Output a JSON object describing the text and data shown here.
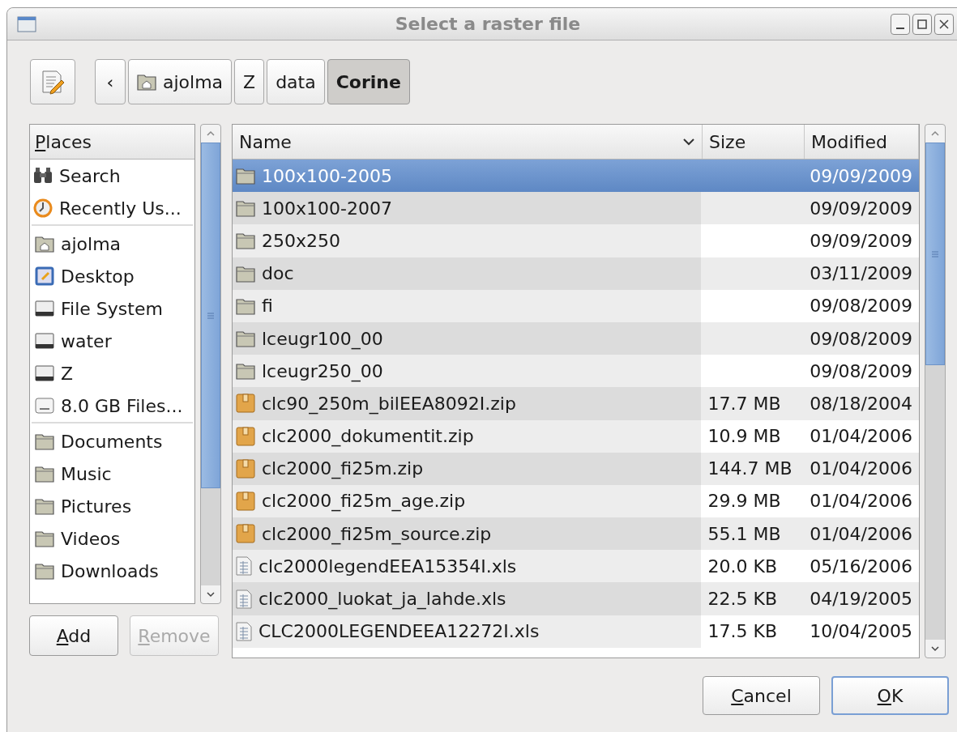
{
  "window": {
    "title": "Select a raster file"
  },
  "path_bar": {
    "back": "‹",
    "items": [
      {
        "label": "ajolma",
        "kind": "home",
        "selected": false
      },
      {
        "label": "Z",
        "kind": "plain",
        "selected": false
      },
      {
        "label": "data",
        "kind": "plain",
        "selected": false
      },
      {
        "label": "Corine",
        "kind": "plain",
        "selected": true
      }
    ]
  },
  "places": {
    "header": "Places",
    "header_mnemonic": true,
    "groups": [
      [
        {
          "label": "Search",
          "kind": "search"
        },
        {
          "label": "Recently Us...",
          "kind": "recent"
        }
      ],
      [
        {
          "label": "ajolma",
          "kind": "home"
        },
        {
          "label": "Desktop",
          "kind": "desktop"
        },
        {
          "label": "File System",
          "kind": "drive"
        },
        {
          "label": "water",
          "kind": "drive"
        },
        {
          "label": "Z",
          "kind": "drive"
        },
        {
          "label": "8.0 GB Files...",
          "kind": "removable"
        }
      ],
      [
        {
          "label": "Documents",
          "kind": "folder"
        },
        {
          "label": "Music",
          "kind": "folder"
        },
        {
          "label": "Pictures",
          "kind": "folder"
        },
        {
          "label": "Videos",
          "kind": "folder"
        },
        {
          "label": "Downloads",
          "kind": "folder"
        }
      ]
    ]
  },
  "place_buttons": [
    {
      "label": "Add",
      "disabled": false,
      "mnemonic": true
    },
    {
      "label": "Remove",
      "disabled": true,
      "mnemonic": true
    }
  ],
  "files": {
    "columns": [
      "Name",
      "Size",
      "Modified"
    ],
    "rows": [
      {
        "name": "100x100-2005",
        "size": "",
        "modified": "09/09/2009",
        "kind": "folder",
        "selected": true
      },
      {
        "name": "100x100-2007",
        "size": "",
        "modified": "09/09/2009",
        "kind": "folder",
        "selected": false
      },
      {
        "name": "250x250",
        "size": "",
        "modified": "09/09/2009",
        "kind": "folder",
        "selected": false
      },
      {
        "name": "doc",
        "size": "",
        "modified": "03/11/2009",
        "kind": "folder",
        "selected": false
      },
      {
        "name": "fi",
        "size": "",
        "modified": "09/08/2009",
        "kind": "folder",
        "selected": false
      },
      {
        "name": "lceugr100_00",
        "size": "",
        "modified": "09/08/2009",
        "kind": "folder",
        "selected": false
      },
      {
        "name": "lceugr250_00",
        "size": "",
        "modified": "09/08/2009",
        "kind": "folder",
        "selected": false
      },
      {
        "name": "clc90_250m_bilEEA8092I.zip",
        "size": "17.7 MB",
        "modified": "08/18/2004",
        "kind": "archive",
        "selected": false
      },
      {
        "name": "clc2000_dokumentit.zip",
        "size": "10.9 MB",
        "modified": "01/04/2006",
        "kind": "archive",
        "selected": false
      },
      {
        "name": "clc2000_fi25m.zip",
        "size": "144.7 MB",
        "modified": "01/04/2006",
        "kind": "archive",
        "selected": false
      },
      {
        "name": "clc2000_fi25m_age.zip",
        "size": "29.9 MB",
        "modified": "01/04/2006",
        "kind": "archive",
        "selected": false
      },
      {
        "name": "clc2000_fi25m_source.zip",
        "size": "55.1 MB",
        "modified": "01/04/2006",
        "kind": "archive",
        "selected": false
      },
      {
        "name": "clc2000legendEEA15354I.xls",
        "size": "20.0 KB",
        "modified": "05/16/2006",
        "kind": "spreadsheet",
        "selected": false
      },
      {
        "name": "clc2000_luokat_ja_lahde.xls",
        "size": "22.5 KB",
        "modified": "04/19/2005",
        "kind": "spreadsheet",
        "selected": false
      },
      {
        "name": "CLC2000LEGENDEEA12272I.xls",
        "size": "17.5 KB",
        "modified": "10/04/2005",
        "kind": "spreadsheet",
        "selected": false
      }
    ]
  },
  "dialog_buttons": [
    {
      "label": "Cancel",
      "mnemonic": true,
      "default": false
    },
    {
      "label": "OK",
      "mnemonic": true,
      "default": true
    }
  ]
}
